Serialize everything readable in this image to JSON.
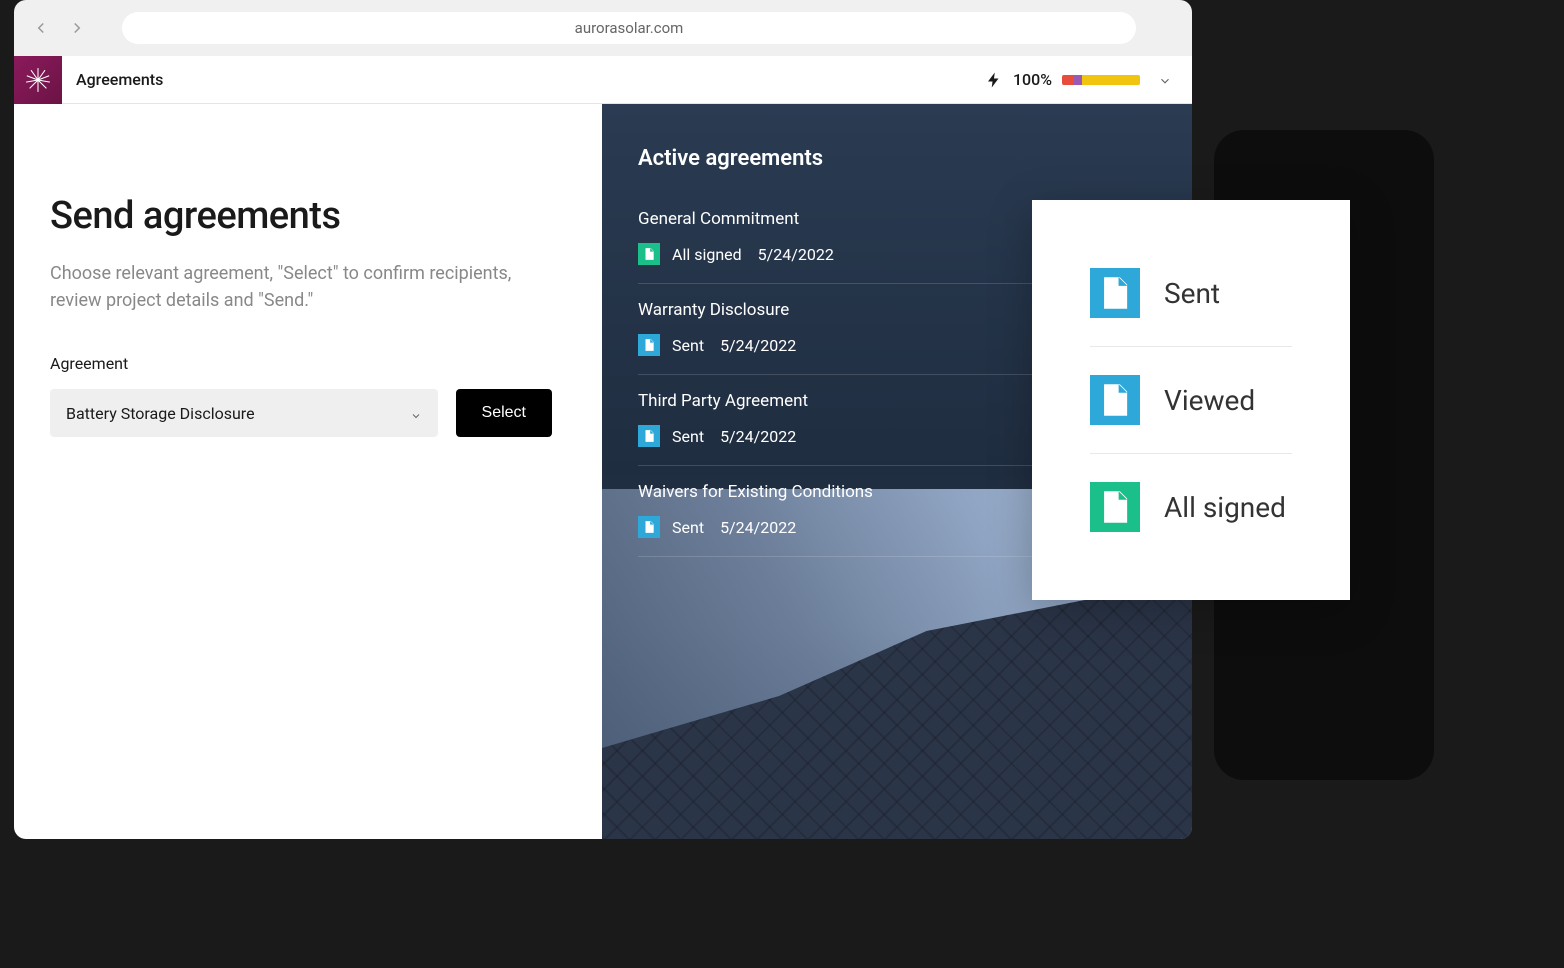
{
  "browser": {
    "url": "aurorasolar.com"
  },
  "header": {
    "title": "Agreements",
    "percent": "100%"
  },
  "left": {
    "heading": "Send agreements",
    "subtitle": "Choose relevant agreement, \"Select\" to confirm recipients, review project details and \"Send.\"",
    "field_label": "Agreement",
    "dropdown_value": "Battery Storage Disclosure",
    "select_label": "Select"
  },
  "right": {
    "heading": "Active agreements",
    "items": [
      {
        "name": "General Commitment",
        "status": "All signed",
        "date": "5/24/2022",
        "color": "green"
      },
      {
        "name": "Warranty Disclosure",
        "status": "Sent",
        "date": "5/24/2022",
        "color": "blue"
      },
      {
        "name": "Third Party Agreement",
        "status": "Sent",
        "date": "5/24/2022",
        "color": "blue"
      },
      {
        "name": "Waivers for Existing Conditions",
        "status": "Sent",
        "date": "5/24/2022",
        "color": "blue"
      }
    ]
  },
  "legend": {
    "items": [
      {
        "label": "Sent",
        "color": "blue"
      },
      {
        "label": "Viewed",
        "color": "blue"
      },
      {
        "label": "All signed",
        "color": "green"
      }
    ]
  }
}
